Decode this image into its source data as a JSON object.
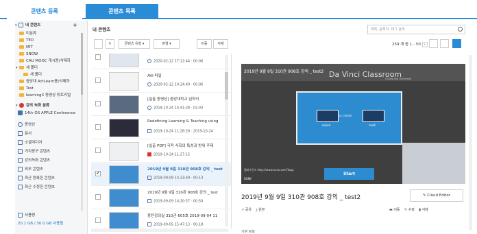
{
  "tabs": {
    "register": "콘텐츠 등록",
    "list": "콘텐츠 목록"
  },
  "sidebar": {
    "my_content": "내 콘텐츠",
    "add_symbol": "+",
    "tree": [
      "미분류",
      "TED",
      "MIT",
      "SNOW",
      "CAU MOOC 게시용(삭제하",
      "새 폴더",
      "새 폴더",
      "중앙대 ActLearn용(삭제하",
      "Test",
      "learningX 동영상 튜토리얼"
    ],
    "lecture_section": "강의 녹화 분류",
    "lecture_item": "14th OS APPLE Conference",
    "types": [
      "동영상",
      "문서",
      "소셜미디어",
      "거치장구 콘텐츠",
      "강의녹화 콘텐츠",
      "외부 콘텐츠",
      "최근 등록한 콘텐츠",
      "최근 수정한 콘텐츠"
    ],
    "usage_label": "사용량",
    "usage_value": "20.1 GB / 30.0 GB 사용됨"
  },
  "toolbar": {
    "title": "내 콘텐츠",
    "search_placeholder": "제목, 등록자, 태그 검색",
    "content_type": "콘텐츠 유형",
    "sort": "정렬",
    "move": "이동",
    "delete": "삭제",
    "pager": "259 개 중 1 - 50"
  },
  "rows": [
    {
      "title": "",
      "meta": "2020-02-12 17:12:44  ·  00:06",
      "icon": "play"
    },
    {
      "title": "AVI 파일",
      "meta": "2020-02-12 10:24:40  ·  00:06",
      "icon": "play"
    },
    {
      "title": "[실출 동영상] 중앙대학교 입학식",
      "meta": "2019-10-24 14:41:28  ·  02:03",
      "icon": "play"
    },
    {
      "title": "Redefining Learning & Teaching using",
      "meta": "2019-10-24 11:28:28  ·  2019-10-24",
      "icon": "doc"
    },
    {
      "title": "[실출 PDF] 국적 사회의 특성과 방위 주제",
      "meta": "2019-10-24 11:27:15",
      "icon": "pdf"
    },
    {
      "title": "2019년 9월 9일 310관 908호 강의 _ test",
      "meta": "2019-09-09 14:23:49  ·  00:13",
      "icon": "doc"
    },
    {
      "title": "2019년 9월 9일 310관 908호 강의 _ test",
      "meta": "2019-09-09 14:20:57  ·  00:50",
      "icon": "doc"
    },
    {
      "title": "동탄강의실 310관 605호 2019-09-04 11",
      "meta": "2019-09-05 15:47:13  ·  00:18",
      "icon": "doc"
    }
  ],
  "preview": {
    "caption": "2019년 9월 9일 310관 908호 강의 _ test2",
    "brand": "Da Vinci Classroom",
    "brand_sub": "Chung-Ang University",
    "overlay": "to collab",
    "mixed": "mixed",
    "multi": "multi",
    "start": "Start",
    "info": "캠퍼스인스\nhttp://www.xxxx.com/Yapp",
    "bottom": "SONY"
  },
  "detail": {
    "title": "2019년 9월 9일 310관 908호 강의 _ test2",
    "cloud_editor": "Cloud Editor",
    "share": "공유",
    "download": "원본",
    "move": "이동",
    "edit": "수정",
    "delete": "삭제",
    "basic_info": "기본 정보"
  }
}
